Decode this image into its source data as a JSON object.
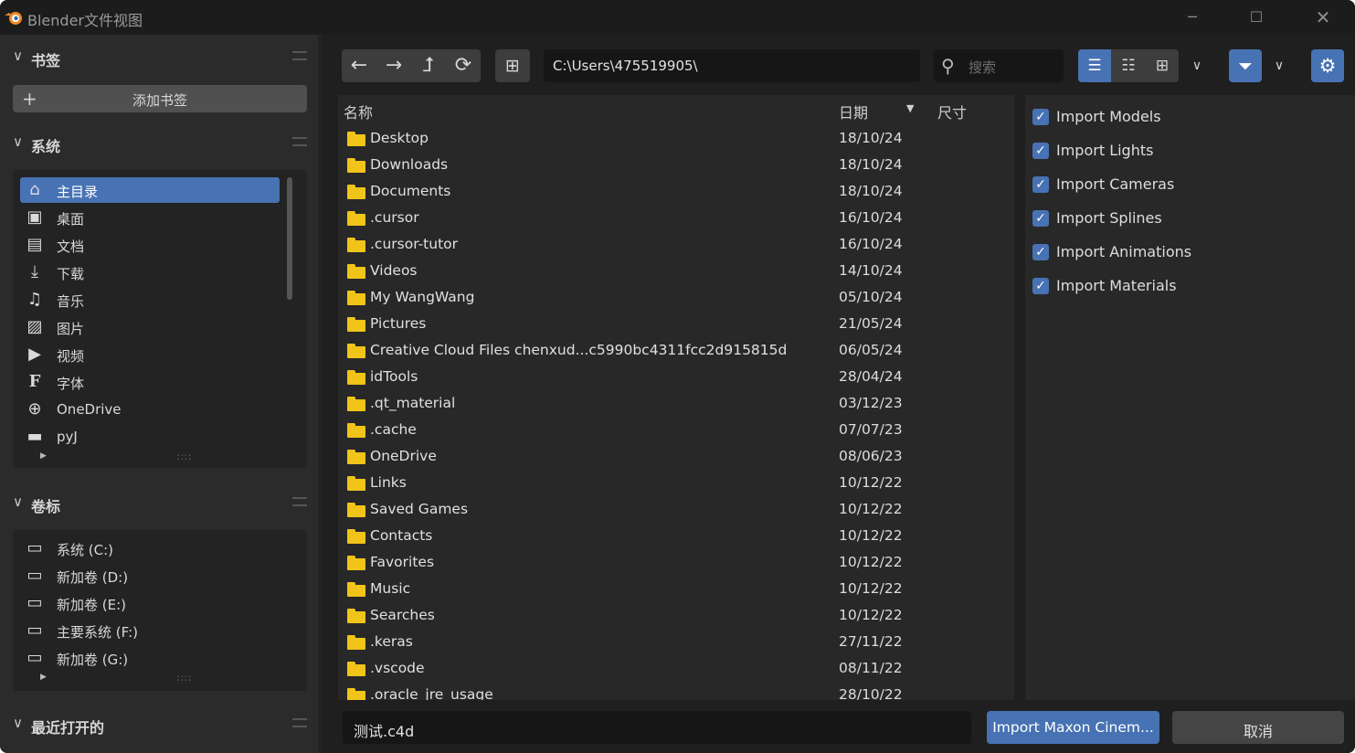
{
  "window": {
    "title": "Blender文件视图",
    "minimize_icon": "minimize-icon",
    "maximize_icon": "maximize-icon",
    "close_icon": "close-icon"
  },
  "sidebar": {
    "bookmarks": {
      "title": "书签",
      "add_label": "添加书签"
    },
    "system": {
      "title": "系统",
      "items": [
        {
          "label": "主目录",
          "icon": "home-icon",
          "selected": true
        },
        {
          "label": "桌面",
          "icon": "desktop-icon"
        },
        {
          "label": "文档",
          "icon": "documents-icon"
        },
        {
          "label": "下载",
          "icon": "download-icon"
        },
        {
          "label": "音乐",
          "icon": "music-icon"
        },
        {
          "label": "图片",
          "icon": "image-icon"
        },
        {
          "label": "视频",
          "icon": "video-icon"
        },
        {
          "label": "字体",
          "icon": "font-icon"
        },
        {
          "label": "OneDrive",
          "icon": "globe-icon"
        },
        {
          "label": "pyJ",
          "icon": "folder-icon"
        }
      ]
    },
    "volumes": {
      "title": "卷标",
      "items": [
        {
          "label": "系统 (C:)",
          "icon": "drive-icon"
        },
        {
          "label": "新加卷 (D:)",
          "icon": "drive-icon"
        },
        {
          "label": "新加卷 (E:)",
          "icon": "drive-icon"
        },
        {
          "label": "主要系统 (F:)",
          "icon": "drive-icon"
        },
        {
          "label": "新加卷 (G:)",
          "icon": "drive-icon"
        }
      ]
    },
    "recent": {
      "title": "最近打开的"
    }
  },
  "toolbar": {
    "path": "C:\\Users\\475519905\\",
    "search_placeholder": "搜索"
  },
  "file_list": {
    "columns": {
      "name": "名称",
      "date": "日期",
      "size": "尺寸"
    },
    "rows": [
      {
        "name": "Desktop",
        "date": "18/10/24"
      },
      {
        "name": "Downloads",
        "date": "18/10/24"
      },
      {
        "name": "Documents",
        "date": "18/10/24"
      },
      {
        "name": ".cursor",
        "date": "16/10/24"
      },
      {
        "name": ".cursor-tutor",
        "date": "16/10/24"
      },
      {
        "name": "Videos",
        "date": "14/10/24"
      },
      {
        "name": "My WangWang",
        "date": "05/10/24"
      },
      {
        "name": "Pictures",
        "date": "21/05/24"
      },
      {
        "name": "Creative Cloud Files chenxud...c5990bc4311fcc2d915815d",
        "date": "06/05/24"
      },
      {
        "name": "idTools",
        "date": "28/04/24"
      },
      {
        "name": ".qt_material",
        "date": "03/12/23"
      },
      {
        "name": ".cache",
        "date": "07/07/23"
      },
      {
        "name": "OneDrive",
        "date": "08/06/23"
      },
      {
        "name": "Links",
        "date": "10/12/22"
      },
      {
        "name": "Saved Games",
        "date": "10/12/22"
      },
      {
        "name": "Contacts",
        "date": "10/12/22"
      },
      {
        "name": "Favorites",
        "date": "10/12/22"
      },
      {
        "name": "Music",
        "date": "10/12/22"
      },
      {
        "name": "Searches",
        "date": "10/12/22"
      },
      {
        "name": ".keras",
        "date": "27/11/22"
      },
      {
        "name": ".vscode",
        "date": "08/11/22"
      },
      {
        "name": ".oracle_jre_usage",
        "date": "28/10/22"
      }
    ]
  },
  "options": {
    "checkboxes": [
      {
        "label": "Import Models",
        "checked": true
      },
      {
        "label": "Import Lights",
        "checked": true
      },
      {
        "label": "Import Cameras",
        "checked": true
      },
      {
        "label": "Import Splines",
        "checked": true
      },
      {
        "label": "Import Animations",
        "checked": true
      },
      {
        "label": "Import Materials",
        "checked": true
      }
    ]
  },
  "footer": {
    "filename": "测试.c4d",
    "import_label": "Import Maxon Cinem...",
    "cancel_label": "取消"
  },
  "colors": {
    "accent": "#4772b3",
    "folder": "#f0c419",
    "background": "#1f1f1f"
  }
}
